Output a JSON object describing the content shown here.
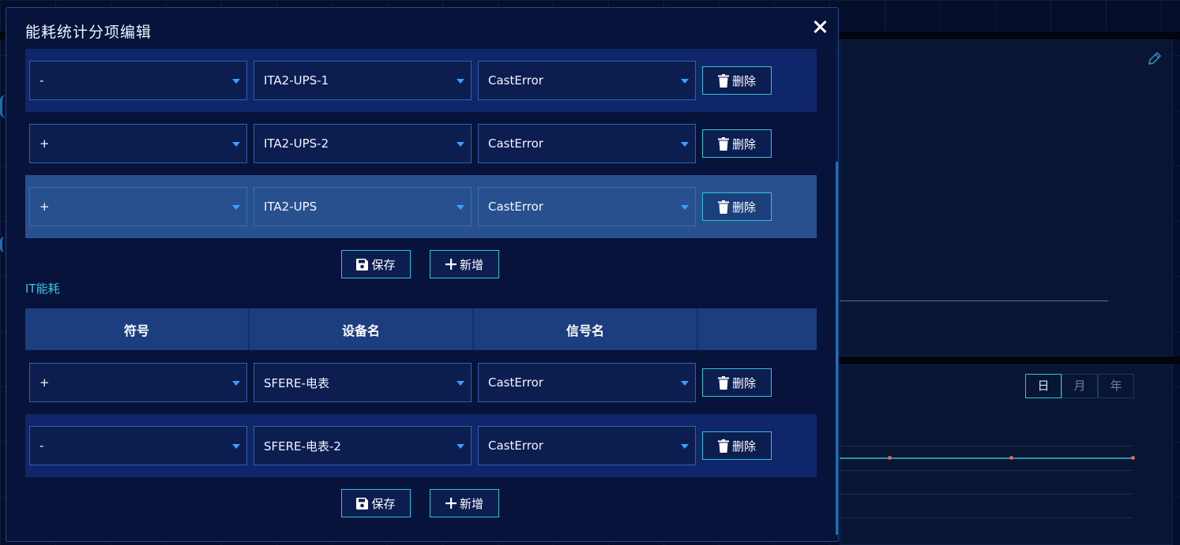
{
  "modal": {
    "title": "能耗统计分项编辑",
    "close_label": "×",
    "section_ups": {
      "rows": [
        {
          "sign": "-",
          "device": "ITA2-UPS-1",
          "signal": "CastError",
          "delete_label": "删除"
        },
        {
          "sign": "+",
          "device": "ITA2-UPS-2",
          "signal": "CastError",
          "delete_label": "删除"
        },
        {
          "sign": "+",
          "device": "ITA2-UPS",
          "signal": "CastError",
          "delete_label": "删除"
        }
      ],
      "save_label": "保存",
      "add_label": "新增"
    },
    "section_it": {
      "title": "IT能耗",
      "headers": [
        "符号",
        "设备名",
        "信号名",
        ""
      ],
      "rows": [
        {
          "sign": "+",
          "device": "SFERE-电表",
          "signal": "CastError",
          "delete_label": "删除"
        },
        {
          "sign": "-",
          "device": "SFERE-电表-2",
          "signal": "CastError",
          "delete_label": "删除"
        }
      ],
      "save_label": "保存",
      "add_label": "新增"
    }
  },
  "background": {
    "tabs": [
      "日",
      "月",
      "年"
    ],
    "active_tab": "日"
  },
  "icons": {
    "close": "close-icon",
    "caret": "caret-down-icon",
    "trash": "trash-icon",
    "save": "save-icon",
    "plus": "plus-icon",
    "pencil": "pencil-icon"
  },
  "colors": {
    "modal_bg": "#07133a",
    "row_blue": "#10266a",
    "row_highlight": "#28508f",
    "accent_cyan": "#2ec5d6",
    "section_title": "#38c6e6",
    "caret_blue": "#3aa0ff"
  }
}
